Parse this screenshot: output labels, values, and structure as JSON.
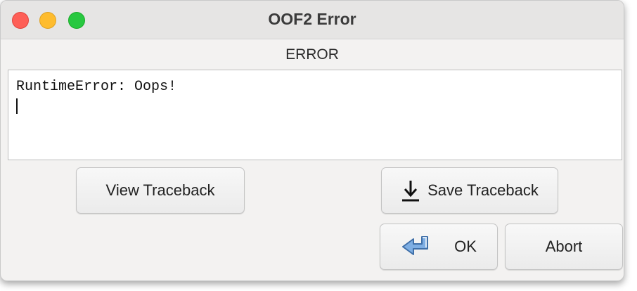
{
  "window": {
    "title": "OOF2 Error"
  },
  "dialog": {
    "heading": "ERROR",
    "message": "RuntimeError: Oops!"
  },
  "buttons": {
    "view_traceback": "View Traceback",
    "save_traceback": "Save Traceback",
    "ok": "OK",
    "abort": "Abort"
  },
  "icons": {
    "save": "download-arrow-icon",
    "ok": "return-arrow-icon"
  },
  "colors": {
    "close": "#fe5f57",
    "minimize": "#febc2e",
    "zoom": "#28c840",
    "ok_icon": "#6f9fd6"
  }
}
